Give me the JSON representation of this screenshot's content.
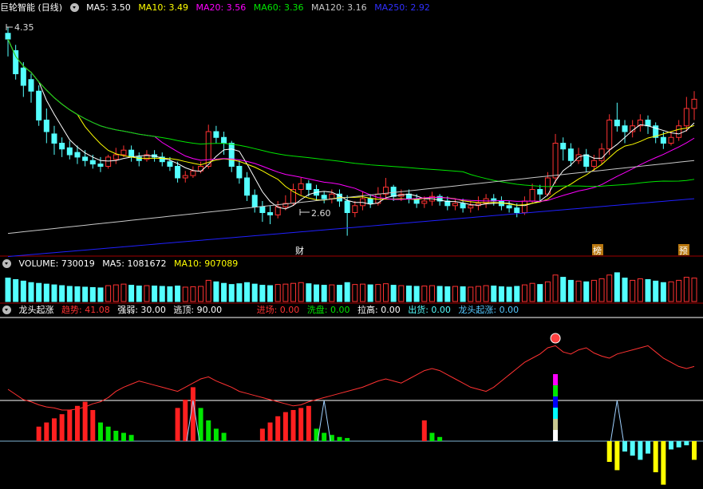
{
  "main_header": {
    "stock": "巨轮智能 (日线)",
    "ma5": "MA5: 3.50",
    "ma10": "MA10: 3.49",
    "ma20": "MA20: 3.56",
    "ma60": "MA60: 3.36",
    "ma120": "MA120: 3.16",
    "ma250": "MA250: 2.92"
  },
  "volume_header": {
    "label": "VOLUME: 730019",
    "ma5": "MA5: 1081672",
    "ma10": "MA10: 907089"
  },
  "indicator_header": {
    "name": "龙头起涨",
    "trend": "趋势: 41.08",
    "strength": "强弱: 30.00",
    "escape": "逃顶: 90.00",
    "entry": "进场: 0.00",
    "wash": "洗盘: 0.00",
    "pull": "拉高: 0.00",
    "out": "出货: 0.00",
    "rise": "龙头起涨: 0.00"
  },
  "price_annotations": {
    "high": "4.35",
    "low": "2.60"
  },
  "event_markers": [
    "财",
    "榜",
    "预"
  ],
  "colors": {
    "up": "#ff3232",
    "down": "#54ffff",
    "ma5": "#ffffff",
    "ma10": "#ffff00",
    "ma20": "#ff00ff",
    "ma60": "#00e600",
    "ma120": "#c8c8c8",
    "ma250": "#2020ff"
  },
  "chart_data": {
    "type": "candlestick",
    "ylim": [
      2.5,
      4.5
    ],
    "grid": false,
    "candles": [
      [
        4.35,
        4.3,
        4.15,
        4.4
      ],
      [
        4.2,
        4.0,
        3.95,
        4.25
      ],
      [
        4.05,
        3.9,
        3.8,
        4.1
      ],
      [
        3.95,
        3.85,
        3.75,
        4.0
      ],
      [
        3.85,
        3.6,
        3.55,
        3.9
      ],
      [
        3.6,
        3.5,
        3.4,
        3.7
      ],
      [
        3.48,
        3.4,
        3.3,
        3.55
      ],
      [
        3.4,
        3.35,
        3.28,
        3.45
      ],
      [
        3.36,
        3.3,
        3.26,
        3.42
      ],
      [
        3.32,
        3.28,
        3.22,
        3.38
      ],
      [
        3.28,
        3.25,
        3.2,
        3.34
      ],
      [
        3.25,
        3.22,
        3.18,
        3.3
      ],
      [
        3.22,
        3.2,
        3.15,
        3.28
      ],
      [
        3.2,
        3.28,
        3.18,
        3.3
      ],
      [
        3.26,
        3.3,
        3.22,
        3.36
      ],
      [
        3.3,
        3.34,
        3.28,
        3.38
      ],
      [
        3.34,
        3.28,
        3.24,
        3.38
      ],
      [
        3.28,
        3.25,
        3.2,
        3.32
      ],
      [
        3.26,
        3.3,
        3.24,
        3.34
      ],
      [
        3.3,
        3.28,
        3.24,
        3.34
      ],
      [
        3.28,
        3.24,
        3.2,
        3.32
      ],
      [
        3.24,
        3.2,
        3.16,
        3.28
      ],
      [
        3.2,
        3.1,
        3.06,
        3.24
      ],
      [
        3.1,
        3.12,
        3.06,
        3.16
      ],
      [
        3.12,
        3.16,
        3.1,
        3.2
      ],
      [
        3.16,
        3.2,
        3.14,
        3.24
      ],
      [
        3.2,
        3.5,
        3.18,
        3.56
      ],
      [
        3.5,
        3.45,
        3.4,
        3.55
      ],
      [
        3.45,
        3.4,
        3.3,
        3.5
      ],
      [
        3.4,
        3.2,
        3.15,
        3.42
      ],
      [
        3.2,
        3.1,
        3.05,
        3.25
      ],
      [
        3.1,
        2.95,
        2.9,
        3.15
      ],
      [
        2.95,
        2.85,
        2.8,
        3.0
      ],
      [
        2.85,
        2.8,
        2.72,
        2.9
      ],
      [
        2.8,
        2.78,
        2.7,
        2.86
      ],
      [
        2.78,
        2.85,
        2.75,
        2.9
      ],
      [
        2.85,
        2.88,
        2.82,
        2.95
      ],
      [
        2.88,
        3.0,
        2.86,
        3.05
      ],
      [
        3.0,
        3.05,
        2.95,
        3.1
      ],
      [
        3.05,
        3.0,
        2.94,
        3.08
      ],
      [
        3.0,
        2.95,
        2.9,
        3.04
      ],
      [
        2.95,
        2.92,
        2.88,
        2.98
      ],
      [
        2.92,
        2.96,
        2.88,
        3.0
      ],
      [
        2.96,
        2.9,
        2.85,
        3.0
      ],
      [
        2.9,
        2.8,
        2.6,
        2.95
      ],
      [
        2.8,
        2.86,
        2.76,
        2.9
      ],
      [
        2.86,
        2.92,
        2.82,
        2.98
      ],
      [
        2.92,
        2.88,
        2.84,
        2.96
      ],
      [
        2.88,
        2.96,
        2.86,
        3.02
      ],
      [
        2.96,
        3.02,
        2.92,
        3.1
      ],
      [
        3.02,
        2.94,
        2.9,
        3.04
      ],
      [
        2.94,
        2.96,
        2.9,
        3.0
      ],
      [
        2.96,
        2.92,
        2.88,
        3.0
      ],
      [
        2.92,
        2.88,
        2.84,
        2.96
      ],
      [
        2.88,
        2.9,
        2.84,
        2.94
      ],
      [
        2.9,
        2.94,
        2.86,
        2.98
      ],
      [
        2.94,
        2.9,
        2.86,
        2.96
      ],
      [
        2.9,
        2.86,
        2.82,
        2.94
      ],
      [
        2.86,
        2.88,
        2.82,
        2.92
      ],
      [
        2.88,
        2.84,
        2.8,
        2.92
      ],
      [
        2.84,
        2.86,
        2.8,
        2.9
      ],
      [
        2.86,
        2.88,
        2.82,
        2.94
      ],
      [
        2.88,
        2.92,
        2.84,
        2.96
      ],
      [
        2.92,
        2.9,
        2.86,
        2.96
      ],
      [
        2.9,
        2.86,
        2.82,
        2.94
      ],
      [
        2.86,
        2.84,
        2.8,
        2.9
      ],
      [
        2.84,
        2.8,
        2.76,
        2.88
      ],
      [
        2.8,
        2.9,
        2.78,
        2.94
      ],
      [
        2.9,
        3.0,
        2.88,
        3.05
      ],
      [
        3.0,
        2.96,
        2.9,
        3.04
      ],
      [
        2.96,
        3.1,
        2.94,
        3.15
      ],
      [
        3.1,
        3.4,
        3.05,
        3.48
      ],
      [
        3.4,
        3.35,
        3.25,
        3.45
      ],
      [
        3.35,
        3.25,
        3.2,
        3.4
      ],
      [
        3.25,
        3.3,
        3.22,
        3.36
      ],
      [
        3.3,
        3.2,
        3.15,
        3.35
      ],
      [
        3.2,
        3.25,
        3.16,
        3.3
      ],
      [
        3.25,
        3.35,
        3.22,
        3.4
      ],
      [
        3.35,
        3.6,
        3.3,
        3.65
      ],
      [
        3.6,
        3.55,
        3.5,
        3.75
      ],
      [
        3.55,
        3.5,
        3.4,
        3.6
      ],
      [
        3.5,
        3.55,
        3.45,
        3.6
      ],
      [
        3.55,
        3.6,
        3.5,
        3.65
      ],
      [
        3.6,
        3.55,
        3.48,
        3.64
      ],
      [
        3.55,
        3.45,
        3.4,
        3.58
      ],
      [
        3.45,
        3.4,
        3.35,
        3.5
      ],
      [
        3.4,
        3.45,
        3.38,
        3.5
      ],
      [
        3.45,
        3.55,
        3.42,
        3.6
      ],
      [
        3.55,
        3.7,
        3.5,
        3.8
      ],
      [
        3.7,
        3.78,
        3.6,
        3.85
      ]
    ],
    "volume": [
      620,
      580,
      540,
      500,
      480,
      460,
      440,
      420,
      400,
      390,
      380,
      370,
      360,
      420,
      440,
      460,
      430,
      410,
      420,
      410,
      400,
      390,
      410,
      380,
      390,
      400,
      560,
      520,
      480,
      450,
      470,
      500,
      460,
      430,
      420,
      450,
      460,
      480,
      500,
      470,
      440,
      430,
      440,
      430,
      500,
      450,
      460,
      440,
      450,
      470,
      430,
      420,
      410,
      400,
      410,
      420,
      400,
      390,
      400,
      390,
      380,
      400,
      420,
      410,
      390,
      380,
      400,
      440,
      480,
      450,
      520,
      700,
      640,
      560,
      540,
      520,
      560,
      600,
      700,
      760,
      620,
      560,
      600,
      580,
      540,
      500,
      520,
      560,
      640,
      620
    ],
    "indicator": {
      "trend_line_y": [
        50,
        45,
        40,
        38,
        35,
        33,
        32,
        30,
        30,
        31,
        33,
        36,
        38,
        42,
        48,
        52,
        55,
        58,
        56,
        54,
        52,
        50,
        48,
        52,
        56,
        60,
        62,
        58,
        55,
        52,
        48,
        46,
        44,
        42,
        40,
        38,
        36,
        34,
        35,
        38,
        40,
        42,
        44,
        46,
        48,
        50,
        52,
        55,
        58,
        60,
        58,
        56,
        60,
        64,
        68,
        70,
        68,
        64,
        60,
        56,
        52,
        50,
        48,
        52,
        58,
        64,
        70,
        76,
        80,
        84,
        90,
        92,
        86,
        84,
        88,
        90,
        85,
        82,
        80,
        84,
        86,
        88,
        90,
        92,
        86,
        80,
        76,
        72,
        70,
        72
      ],
      "bars_red": [
        {
          "i": 4,
          "v": 14
        },
        {
          "i": 5,
          "v": 18
        },
        {
          "i": 6,
          "v": 22
        },
        {
          "i": 7,
          "v": 26
        },
        {
          "i": 8,
          "v": 30
        },
        {
          "i": 9,
          "v": 34
        },
        {
          "i": 10,
          "v": 38
        },
        {
          "i": 11,
          "v": 30
        },
        {
          "i": 22,
          "v": 32
        },
        {
          "i": 23,
          "v": 40
        },
        {
          "i": 24,
          "v": 52
        },
        {
          "i": 33,
          "v": 12
        },
        {
          "i": 34,
          "v": 18
        },
        {
          "i": 35,
          "v": 24
        },
        {
          "i": 36,
          "v": 28
        },
        {
          "i": 37,
          "v": 30
        },
        {
          "i": 38,
          "v": 32
        },
        {
          "i": 39,
          "v": 34
        },
        {
          "i": 54,
          "v": 20
        }
      ],
      "bars_green": [
        {
          "i": 12,
          "v": 18
        },
        {
          "i": 13,
          "v": 14
        },
        {
          "i": 14,
          "v": 10
        },
        {
          "i": 15,
          "v": 8
        },
        {
          "i": 16,
          "v": 6
        },
        {
          "i": 25,
          "v": 32
        },
        {
          "i": 26,
          "v": 20
        },
        {
          "i": 27,
          "v": 12
        },
        {
          "i": 28,
          "v": 8
        },
        {
          "i": 40,
          "v": 12
        },
        {
          "i": 41,
          "v": 8
        },
        {
          "i": 42,
          "v": 6
        },
        {
          "i": 43,
          "v": 4
        },
        {
          "i": 44,
          "v": 3
        },
        {
          "i": 55,
          "v": 8
        },
        {
          "i": 56,
          "v": 4
        }
      ],
      "bars_cyan_neg": [
        {
          "i": 80,
          "v": 10
        },
        {
          "i": 81,
          "v": 14
        },
        {
          "i": 82,
          "v": 18
        },
        {
          "i": 83,
          "v": 12
        },
        {
          "i": 86,
          "v": 8
        },
        {
          "i": 87,
          "v": 6
        },
        {
          "i": 88,
          "v": 4
        }
      ],
      "bars_yellow_neg": [
        {
          "i": 78,
          "v": 20
        },
        {
          "i": 79,
          "v": 28
        },
        {
          "i": 84,
          "v": 30
        },
        {
          "i": 85,
          "v": 42
        },
        {
          "i": 89,
          "v": 18
        }
      ]
    }
  }
}
